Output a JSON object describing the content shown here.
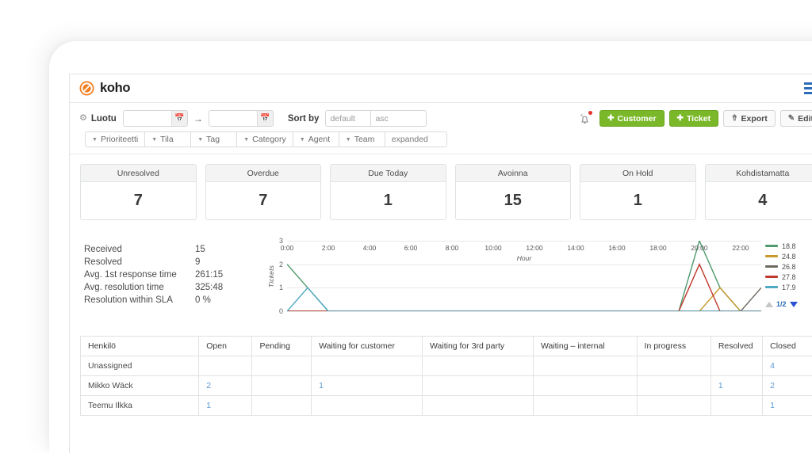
{
  "app": {
    "brand_name": "koho",
    "brand_icon": "koho-logo-icon",
    "menu_icon": "hamburger-menu-icon"
  },
  "filters": {
    "gear_icon": "gear-icon",
    "created_label": "Luotu",
    "date_from_value": "",
    "date_from_placeholder": "",
    "date_to_value": "",
    "date_to_placeholder": "",
    "calendar_icon": "calendar-icon",
    "range_arrow": "→",
    "sort_by_label": "Sort by",
    "sort_field_value": "default",
    "sort_dir_value": "asc",
    "chips": [
      {
        "label": "Prioriteetti",
        "caret": true
      },
      {
        "label": "Tila",
        "caret": true
      },
      {
        "label": "Tag",
        "caret": true
      },
      {
        "label": "Category",
        "caret": true
      },
      {
        "label": "Agent",
        "caret": true
      },
      {
        "label": "Team",
        "caret": true
      },
      {
        "label": "expanded",
        "caret": false
      }
    ]
  },
  "toolbar": {
    "bell_icon": "notification-bell-icon",
    "bell_badge": true,
    "customer_label": "Customer",
    "ticket_label": "Ticket",
    "export_label": "Export",
    "edit_label": "Edit",
    "plus_glyph": "✦",
    "export_icon": "upload-icon",
    "edit_icon": "pencil-square-icon",
    "green": "#7ab829"
  },
  "kpis": [
    {
      "title": "Unresolved",
      "value": "7"
    },
    {
      "title": "Overdue",
      "value": "7"
    },
    {
      "title": "Due Today",
      "value": "1"
    },
    {
      "title": "Avoinna",
      "value": "15"
    },
    {
      "title": "On Hold",
      "value": "1"
    },
    {
      "title": "Kohdistamatta",
      "value": "4"
    }
  ],
  "stats": [
    {
      "name": "Received",
      "value": "15"
    },
    {
      "name": "Resolved",
      "value": "9"
    },
    {
      "name": "Avg. 1st response time",
      "value": "261:15"
    },
    {
      "name": "Avg. resolution time",
      "value": "325:48"
    },
    {
      "name": "Resolution within SLA",
      "value": "0 %"
    }
  ],
  "chart_pager": {
    "up_icon": "triangle-up-icon",
    "down_icon": "triangle-down-icon",
    "page_text": "1/2"
  },
  "chart_data": {
    "type": "line",
    "title": "",
    "xlabel": "Hour",
    "ylabel": "Tickets",
    "ylim": [
      0,
      3
    ],
    "yticks": [
      0,
      1,
      2,
      3
    ],
    "grid": true,
    "legend_position": "right",
    "x": [
      "0:00",
      "1:00",
      "2:00",
      "3:00",
      "4:00",
      "5:00",
      "6:00",
      "7:00",
      "8:00",
      "9:00",
      "10:00",
      "11:00",
      "12:00",
      "13:00",
      "14:00",
      "15:00",
      "16:00",
      "17:00",
      "18:00",
      "19:00",
      "20:00",
      "21:00",
      "22:00",
      "23:00"
    ],
    "xticklabels": [
      "0:00",
      "2:00",
      "4:00",
      "6:00",
      "8:00",
      "10:00",
      "12:00",
      "14:00",
      "16:00",
      "18:00",
      "20:00",
      "22:00"
    ],
    "series": [
      {
        "name": "18.8",
        "color": "#4f9a6e",
        "values": [
          2,
          1,
          0,
          0,
          0,
          0,
          0,
          0,
          0,
          0,
          0,
          0,
          0,
          0,
          0,
          0,
          0,
          0,
          0,
          0,
          3,
          1,
          0,
          0
        ]
      },
      {
        "name": "24.8",
        "color": "#c79a2b",
        "values": [
          0,
          0,
          0,
          0,
          0,
          0,
          0,
          0,
          0,
          0,
          0,
          0,
          0,
          0,
          0,
          0,
          0,
          0,
          0,
          0,
          0,
          1,
          0,
          0
        ]
      },
      {
        "name": "26.8",
        "color": "#6e6a60",
        "values": [
          0,
          0,
          0,
          0,
          0,
          0,
          0,
          0,
          0,
          0,
          0,
          0,
          0,
          0,
          0,
          0,
          0,
          0,
          0,
          0,
          0,
          0,
          0,
          1
        ]
      },
      {
        "name": "27.8",
        "color": "#c0392b",
        "values": [
          0,
          0,
          0,
          0,
          0,
          0,
          0,
          0,
          0,
          0,
          0,
          0,
          0,
          0,
          0,
          0,
          0,
          0,
          0,
          0,
          2,
          0,
          0,
          0
        ]
      },
      {
        "name": "17.9",
        "color": "#4fa8c4",
        "values": [
          0,
          1,
          0,
          0,
          0,
          0,
          0,
          0,
          0,
          0,
          0,
          0,
          0,
          0,
          0,
          0,
          0,
          0,
          0,
          0,
          0,
          0,
          0,
          0
        ]
      }
    ]
  },
  "table": {
    "columns": [
      "Henkilö",
      "Open",
      "Pending",
      "Waiting for customer",
      "Waiting for 3rd party",
      "Waiting – internal",
      "In progress",
      "Resolved",
      "Closed"
    ],
    "rows": [
      {
        "cells": [
          "Unassigned",
          "",
          "",
          "",
          "",
          "",
          "",
          "",
          "4"
        ]
      },
      {
        "cells": [
          "Mikko Wäck",
          "2",
          "",
          "1",
          "",
          "",
          "",
          "1",
          "2"
        ]
      },
      {
        "cells": [
          "Teemu Ilkka",
          "1",
          "",
          "",
          "",
          "",
          "",
          "",
          "1"
        ]
      }
    ]
  }
}
